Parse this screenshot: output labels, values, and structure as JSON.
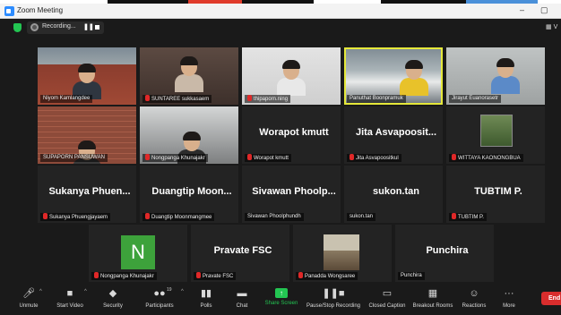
{
  "window": {
    "title": "Zoom Meeting",
    "minimize": "–",
    "restore": "▢"
  },
  "top_strip": {
    "colors": [
      "#111111",
      "#e03b2b",
      "#111111",
      "#4a90d9"
    ]
  },
  "meeting_bar": {
    "recording_label": "Recording...",
    "pause": "❚❚",
    "view_label": "V"
  },
  "tiles": [
    {
      "label": "Niyom Kamlangdee",
      "muted": false
    },
    {
      "label": "SUNTAREE sukkasaem",
      "muted": true
    },
    {
      "label": "thipaporn.ning",
      "muted": true
    },
    {
      "label": "Panuthat Boonpramuk",
      "muted": false
    },
    {
      "label": "Jirayut Euanorasetr",
      "muted": false
    },
    {
      "label": "SUPAPORN PANSUWAN",
      "muted": false
    },
    {
      "label": "Nongpanga Khunajakr",
      "muted": true
    },
    {
      "name": "Worapot kmutt",
      "label": "Worapot kmutt",
      "muted": true
    },
    {
      "name": "Jita Asvapoosit...",
      "label": "Jita Asvapoositkul",
      "muted": true
    },
    {
      "label": "WITTAYA KAONONGBUA",
      "muted": true
    },
    {
      "name": "Sukanya Phuen...",
      "label": "Sukanya Phuengjayaem",
      "muted": true
    },
    {
      "name": "Duangtip Moon...",
      "label": "Duangtip Moonmangmee",
      "muted": true
    },
    {
      "name": "Sivawan Phoolp...",
      "label": "Sivawan Phoolphundh",
      "muted": false
    },
    {
      "name": "sukon.tan",
      "label": "sukon.tan",
      "muted": false
    },
    {
      "name": "TUBTIM P.",
      "label": "TUBTIM P.",
      "muted": true
    },
    {
      "initial": "N",
      "label": "Nongpanga Khunajakr",
      "muted": true
    },
    {
      "name": "Pravate FSC",
      "label": "Pravate FSC",
      "muted": true
    },
    {
      "label": "Panadda Wongsaree",
      "muted": true
    },
    {
      "name": "Punchira",
      "label": "Punchira",
      "muted": false
    }
  ],
  "toolbar": {
    "unmute": "Unmute",
    "start_video": "Start Video",
    "security": "Security",
    "participants": "Participants",
    "participants_count": "19",
    "polls": "Polls",
    "chat": "Chat",
    "share_screen": "Share Screen",
    "pause_stop_recording": "Pause/Stop Recording",
    "closed_caption": "Closed Caption",
    "breakout_rooms": "Breakout Rooms",
    "reactions": "Reactions",
    "more": "More",
    "end": "End"
  },
  "colors": {
    "accent": "#2d8cff",
    "share_green": "#23c552",
    "end_red": "#d92d2d",
    "active_speaker": "#e5e83a",
    "mute_red": "#e02828"
  }
}
